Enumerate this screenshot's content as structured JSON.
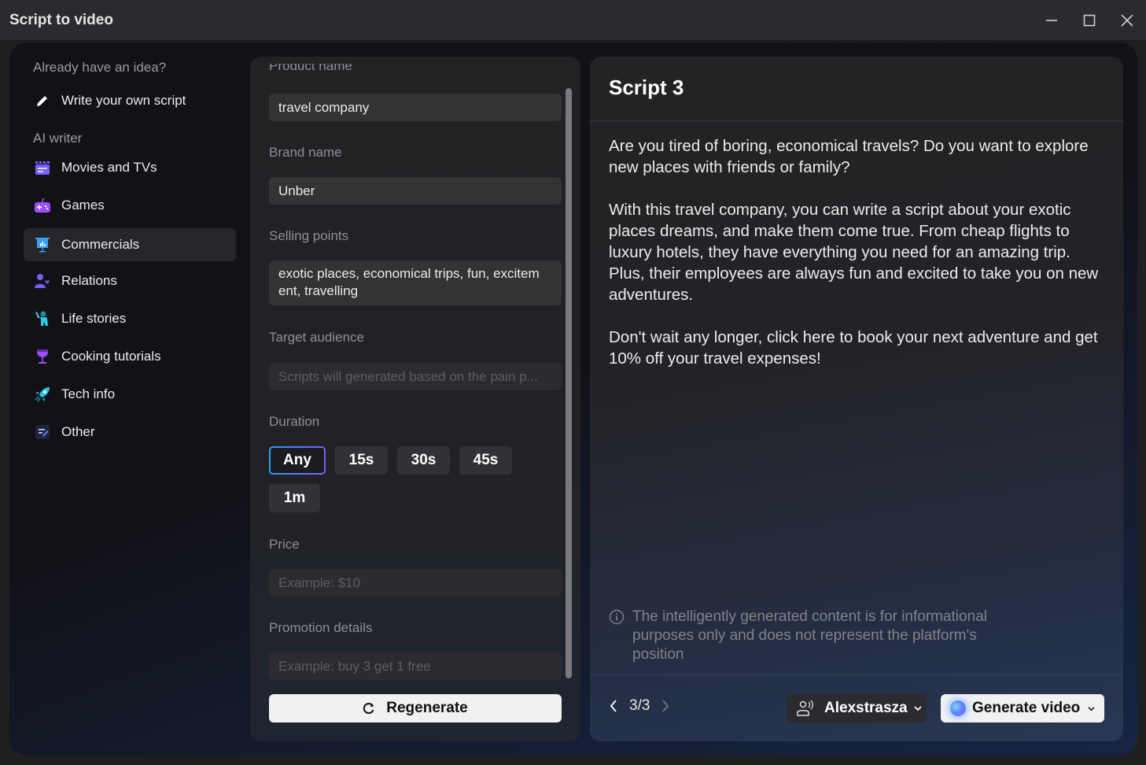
{
  "window": {
    "title": "Script to video",
    "controls": [
      "minimize",
      "maximize",
      "close"
    ]
  },
  "sidebar": {
    "heading_idea": "Already have an idea?",
    "write_own": {
      "label": "Write your own script",
      "icon": "pencil-icon"
    },
    "heading_ai": "AI writer",
    "items": [
      {
        "label": "Movies and TVs",
        "icon": "clapperboard-icon",
        "active": false
      },
      {
        "label": "Games",
        "icon": "gamepad-icon",
        "active": false
      },
      {
        "label": "Commercials",
        "icon": "presentation-chart-icon",
        "active": true
      },
      {
        "label": "Relations",
        "icon": "person-heart-icon",
        "active": false
      },
      {
        "label": "Life stories",
        "icon": "person-waving-icon",
        "active": false
      },
      {
        "label": "Cooking tutorials",
        "icon": "wine-glass-icon",
        "active": false
      },
      {
        "label": "Tech info",
        "icon": "rocket-icon",
        "active": false
      },
      {
        "label": "Other",
        "icon": "note-edit-icon",
        "active": false
      }
    ],
    "colors": {
      "purple": "#7b5cff",
      "violet": "#9b4dff",
      "blue": "#3aa0ff",
      "cyan": "#2fc6e0"
    }
  },
  "form": {
    "product_name": {
      "label": "Product name",
      "value": "travel company"
    },
    "brand_name": {
      "label": "Brand name",
      "value": "Unber"
    },
    "selling_points": {
      "label": "Selling points",
      "value": "exotic places, economical trips, fun, excitem ent, travelling"
    },
    "target_audience": {
      "label": "Target audience",
      "placeholder": "Scripts will generated based on the pain p..."
    },
    "duration": {
      "label": "Duration",
      "options": [
        "Any",
        "15s",
        "30s",
        "45s",
        "1m"
      ],
      "selected": "Any"
    },
    "price": {
      "label": "Price",
      "placeholder": "Example: $10"
    },
    "promotion": {
      "label": "Promotion details",
      "placeholder": "Example: buy 3 get 1 free"
    },
    "regenerate_label": "Regenerate"
  },
  "script": {
    "title": "Script 3",
    "paragraphs": [
      "Are you tired of boring, economical travels? Do you want to explore new places with friends or family?",
      "With this travel company, you can write a script about your exotic places dreams, and make them come true. From cheap flights to luxury hotels, they have everything you need for an amazing trip. Plus, their employees are always fun and excited to take you on new adventures.",
      "Don't wait any longer, click here to book your next adventure and get 10% off your travel expenses!"
    ],
    "disclaimer": "The intelligently generated content is for informational purposes only and does not represent the platform's position",
    "pager": "3/3",
    "voice": "Alexstrasza",
    "generate_label": "Generate video"
  }
}
